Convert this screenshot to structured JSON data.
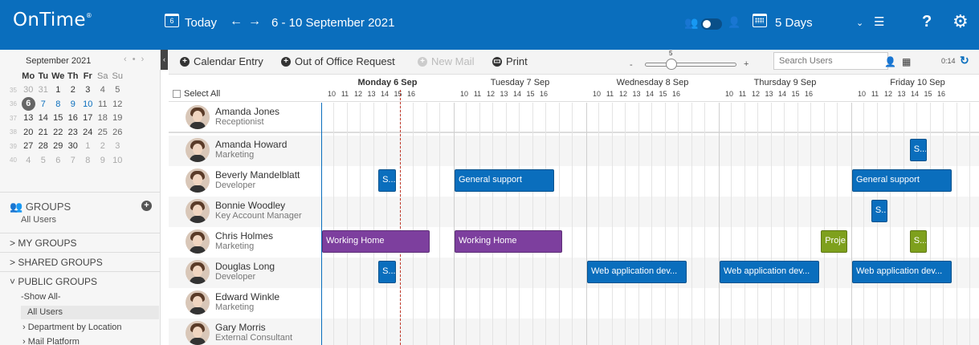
{
  "header": {
    "logo": "OnTime",
    "logo_mark": "®",
    "today_label": "Today",
    "today_icon": "6",
    "prev": "←",
    "next": "→",
    "date_range": "6 - 10 September 2021",
    "view_label": "5 Days",
    "chevron": "⌄",
    "filter_icon": "☰",
    "help": "?",
    "gear": "⚙",
    "people_icon": "👥",
    "person_icon": "👤"
  },
  "mini_calendar": {
    "title": "September 2021",
    "nav": "‹ • ›",
    "weekdays": [
      "Mo",
      "Tu",
      "We",
      "Th",
      "Fr",
      "Sa",
      "Su"
    ],
    "weeks": [
      {
        "wk": "35",
        "days": [
          "30",
          "31",
          "1",
          "2",
          "3",
          "4",
          "5"
        ]
      },
      {
        "wk": "36",
        "days": [
          "6",
          "7",
          "8",
          "9",
          "10",
          "11",
          "12"
        ]
      },
      {
        "wk": "37",
        "days": [
          "13",
          "14",
          "15",
          "16",
          "17",
          "18",
          "19"
        ]
      },
      {
        "wk": "38",
        "days": [
          "20",
          "21",
          "22",
          "23",
          "24",
          "25",
          "26"
        ]
      },
      {
        "wk": "39",
        "days": [
          "27",
          "28",
          "29",
          "30",
          "1",
          "2",
          "3"
        ]
      },
      {
        "wk": "40",
        "days": [
          "4",
          "5",
          "6",
          "7",
          "8",
          "9",
          "10"
        ]
      }
    ]
  },
  "sidebar": {
    "groups_title": "GROUPS",
    "groups_icon": "👥",
    "groups_sub": "All Users",
    "add": "+",
    "my_groups": "> MY GROUPS",
    "shared_groups": "> SHARED GROUPS",
    "public_groups": "˅ PUBLIC GROUPS",
    "show_all": "-Show All-",
    "all_users": "All Users",
    "dept_location": "› Department by Location",
    "mail_platform": "› Mail Platform"
  },
  "toolbar": {
    "collapse": "‹",
    "calendar_entry": "Calendar Entry",
    "out_of_office": "Out of Office Request",
    "new_mail": "New Mail",
    "print": "Print",
    "zoom_minus": "-",
    "zoom_plus": "+",
    "zoom_value": "5",
    "search_placeholder": "Search Users",
    "user_icon": "👤",
    "cal_icon": "▦",
    "refresh_time": "0:14",
    "refresh_icon": "↻"
  },
  "calendar": {
    "select_all": "Select All",
    "days": [
      "Monday 6 Sep",
      "Tuesday 7 Sep",
      "Wednesday 8 Sep",
      "Thursday 9 Sep",
      "Friday 10 Sep"
    ],
    "hours": [
      "10",
      "11",
      "12",
      "13",
      "14",
      "15",
      "16"
    ],
    "people": [
      {
        "name": "Amanda Jones",
        "role": "Receptionist"
      },
      {
        "name": "Amanda Howard",
        "role": "Marketing"
      },
      {
        "name": "Beverly Mandelblatt",
        "role": "Developer"
      },
      {
        "name": "Bonnie Woodley",
        "role": "Key Account Manager"
      },
      {
        "name": "Chris Holmes",
        "role": "Marketing"
      },
      {
        "name": "Douglas Long",
        "role": "Developer"
      },
      {
        "name": "Edward Winkle",
        "role": "Marketing"
      },
      {
        "name": "Gary Morris",
        "role": "External Consultant"
      }
    ],
    "events": [
      {
        "row": 1,
        "day": 4,
        "start": 13.5,
        "end": 14.8,
        "label": "S...",
        "color": "#0a6ebd"
      },
      {
        "row": 2,
        "day": 0,
        "start": 13.4,
        "end": 14.7,
        "label": "S...",
        "color": "#0a6ebd"
      },
      {
        "row": 2,
        "day": 1,
        "start": 10.0,
        "end": 17.5,
        "label": "General support",
        "color": "#0a6ebd"
      },
      {
        "row": 2,
        "day": 4,
        "start": 10.0,
        "end": 17.5,
        "label": "General support",
        "color": "#0a6ebd"
      },
      {
        "row": 3,
        "day": 4,
        "start": 10.6,
        "end": 11.8,
        "label": "S...",
        "color": "#0a6ebd"
      },
      {
        "row": 4,
        "day": 0,
        "start": 10.0,
        "end": 18.0,
        "label": "Working Home",
        "color": "#7d3f9e"
      },
      {
        "row": 4,
        "day": 1,
        "start": 10.0,
        "end": 18.0,
        "label": "Working Home",
        "color": "#7d3f9e"
      },
      {
        "row": 4,
        "day": 3,
        "start": 16.8,
        "end": 18.9,
        "label": "Proje...",
        "color": "#7ea01d"
      },
      {
        "row": 4,
        "day": 4,
        "start": 13.5,
        "end": 14.8,
        "label": "S...",
        "color": "#7ea01d"
      },
      {
        "row": 5,
        "day": 0,
        "start": 13.4,
        "end": 14.7,
        "label": "S...",
        "color": "#0a6ebd"
      },
      {
        "row": 5,
        "day": 2,
        "start": 10.0,
        "end": 17.5,
        "label": "Web application dev...",
        "color": "#0a6ebd"
      },
      {
        "row": 5,
        "day": 3,
        "start": 10.0,
        "end": 17.5,
        "label": "Web application dev...",
        "color": "#0a6ebd"
      },
      {
        "row": 5,
        "day": 4,
        "start": 10.0,
        "end": 17.5,
        "label": "Web application dev...",
        "color": "#0a6ebd"
      }
    ],
    "now_hour": 15.0
  }
}
